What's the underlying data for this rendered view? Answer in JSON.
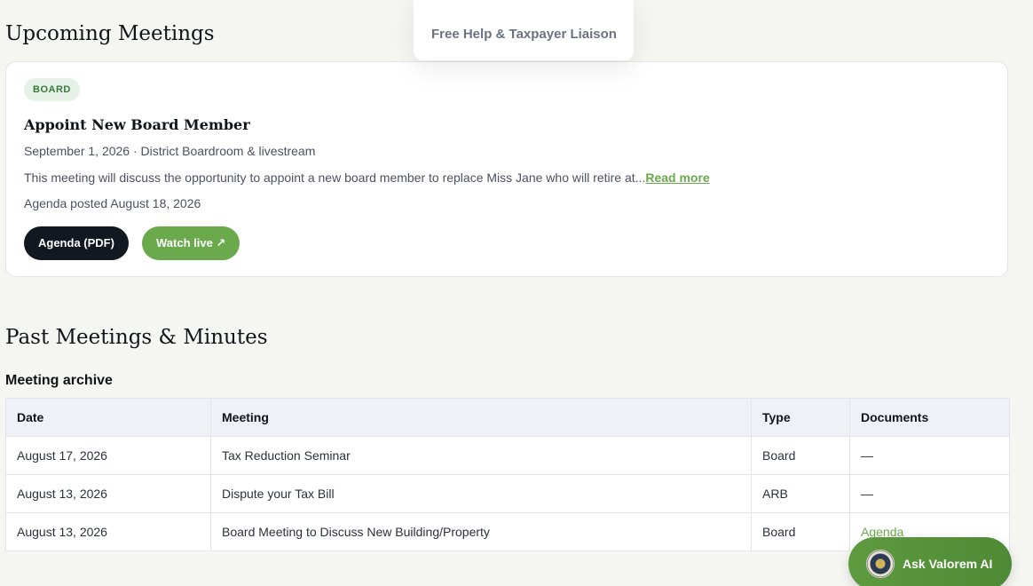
{
  "dropdown": {
    "item_label": "Free Help & Taxpayer Liaison"
  },
  "upcoming": {
    "title": "Upcoming Meetings",
    "meeting": {
      "badge": "BOARD",
      "title": "Appoint New Board Member",
      "meta": "September 1, 2026 · District Boardroom & livestream",
      "description": "This meeting will discuss the opportunity to appoint a new board member to replace Miss Jane who will retire at...",
      "read_more": "Read more",
      "posted": "Agenda posted August 18, 2026",
      "agenda_button": "Agenda (PDF)",
      "watch_button": "Watch live ↗"
    }
  },
  "past": {
    "title": "Past Meetings & Minutes",
    "caption": "Meeting archive",
    "columns": [
      "Date",
      "Meeting",
      "Type",
      "Documents"
    ],
    "rows": [
      {
        "date": "August 17, 2026",
        "meeting": "Tax Reduction Seminar",
        "type": "Board",
        "documents": "—"
      },
      {
        "date": "August 13, 2026",
        "meeting": "Dispute your Tax Bill",
        "type": "ARB",
        "documents": "—"
      },
      {
        "date": "August 13, 2026",
        "meeting": "Board Meeting to Discuss New Building/Property",
        "type": "Board",
        "documents": "Agenda"
      }
    ]
  },
  "ai_assistant": {
    "label": "Ask Valorem AI"
  },
  "colors": {
    "accent_green": "#6aa94c",
    "dark_button": "#111820",
    "badge_bg": "#e6f1e8",
    "page_bg": "#f5f5f2"
  }
}
